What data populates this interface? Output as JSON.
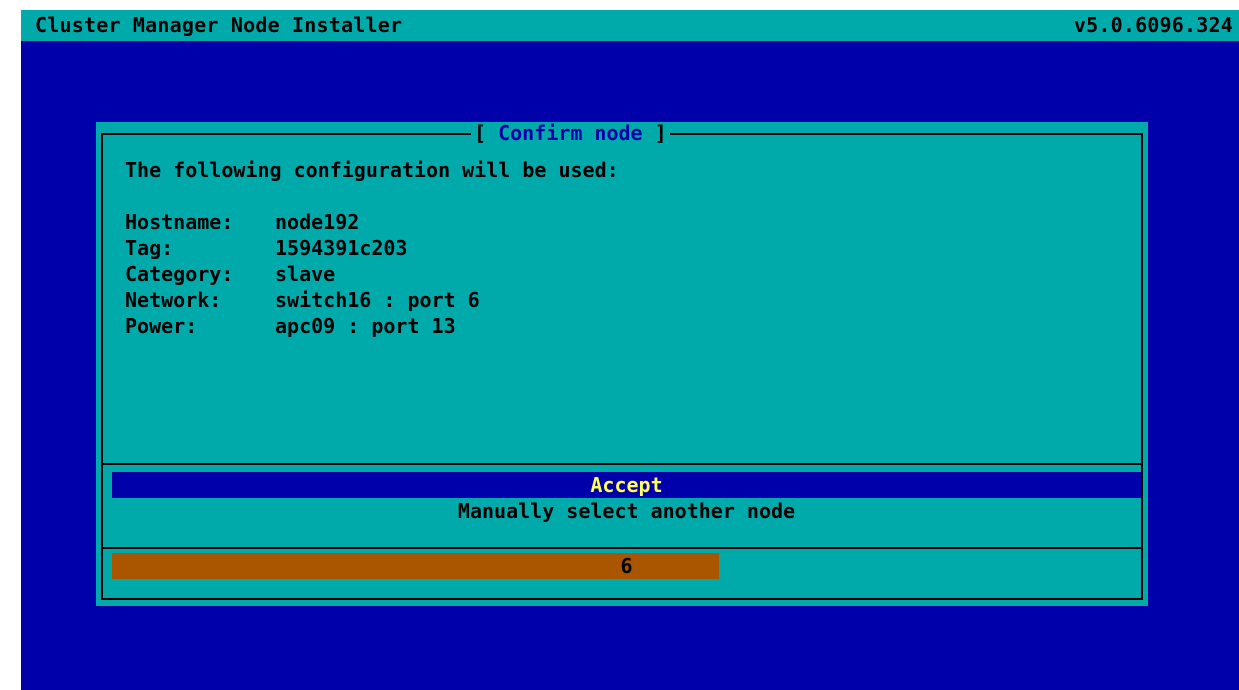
{
  "app": {
    "title": "Cluster Manager Node Installer",
    "version": "v5.0.6096.324"
  },
  "dialog": {
    "title": "Confirm node",
    "title_left": "[ ",
    "title_right": " ]",
    "intro": "The following configuration will be used:",
    "fields": [
      {
        "label": "Hostname:",
        "value": "node192"
      },
      {
        "label": "Tag:",
        "value": "1594391c203"
      },
      {
        "label": "Category:",
        "value": "slave"
      },
      {
        "label": "Network:",
        "value": "switch16 : port 6"
      },
      {
        "label": "Power:",
        "value": "apc09 : port 13"
      }
    ],
    "options": [
      {
        "label": "Accept",
        "selected": true
      },
      {
        "label": "Manually select another node",
        "selected": false
      }
    ],
    "countdown": {
      "value": "6",
      "fraction": 0.59
    }
  },
  "colors": {
    "background": "#0000aa",
    "panel": "#00aaaa",
    "highlight_text": "#ffff55",
    "progress": "#aa5500"
  }
}
